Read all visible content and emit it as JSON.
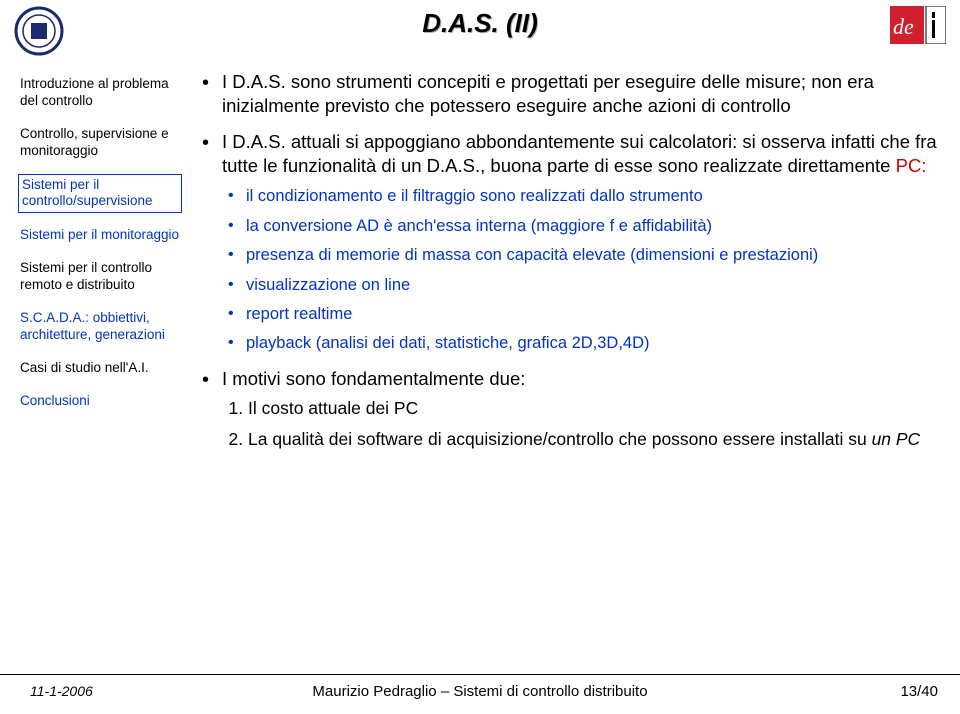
{
  "header": {
    "title": "D.A.S. (II)"
  },
  "sidebar": {
    "items": [
      {
        "label": "Introduzione al problema del controllo",
        "blue": false,
        "active": false
      },
      {
        "label": "Controllo, supervisione e monitoraggio",
        "blue": false,
        "active": false
      },
      {
        "label": "Sistemi per il controllo/supervisione",
        "blue": true,
        "active": true
      },
      {
        "label": "Sistemi per il monitoraggio",
        "blue": true,
        "active": false
      },
      {
        "label": "Sistemi per il controllo remoto e distribuito",
        "blue": false,
        "active": false
      },
      {
        "label": "S.C.A.D.A.: obbiettivi, architetture, generazioni",
        "blue": true,
        "active": false
      },
      {
        "label": "Casi di studio nell'A.I.",
        "blue": false,
        "active": false
      },
      {
        "label": "Conclusioni",
        "blue": true,
        "active": false
      }
    ]
  },
  "content": {
    "b1": "I D.A.S. sono strumenti concepiti e progettati per eseguire delle misure; non era inizialmente previsto che potessero eseguire anche azioni di controllo",
    "b2_pre": "I D.A.S. attuali si appoggiano abbondantemente sui calcolatori: si osserva infatti che fra tutte le funzionalità di un D.A.S., buona parte di esse sono realizzate direttamente ",
    "b2_pc": "PC:",
    "sub": [
      "il condizionamento e il filtraggio sono realizzati dallo strumento",
      "la conversione AD è anch'essa interna (maggiore f e affidabilità)",
      "presenza di memorie di massa con capacità elevate (dimensioni e prestazioni)",
      "visualizzazione on line",
      "report realtime",
      "playback  (analisi dei dati, statistiche, grafica 2D,3D,4D)"
    ],
    "b3": "I motivi sono fondamentalmente due:",
    "num1": "Il costo attuale dei PC",
    "num2_pre": "La qualità dei software di acquisizione/controllo che possono essere installati su ",
    "num2_it": "un PC"
  },
  "footer": {
    "date": "11-1-2006",
    "author": "Maurizio Pedraglio – Sistemi di controllo distribuito",
    "page": "13/40"
  }
}
